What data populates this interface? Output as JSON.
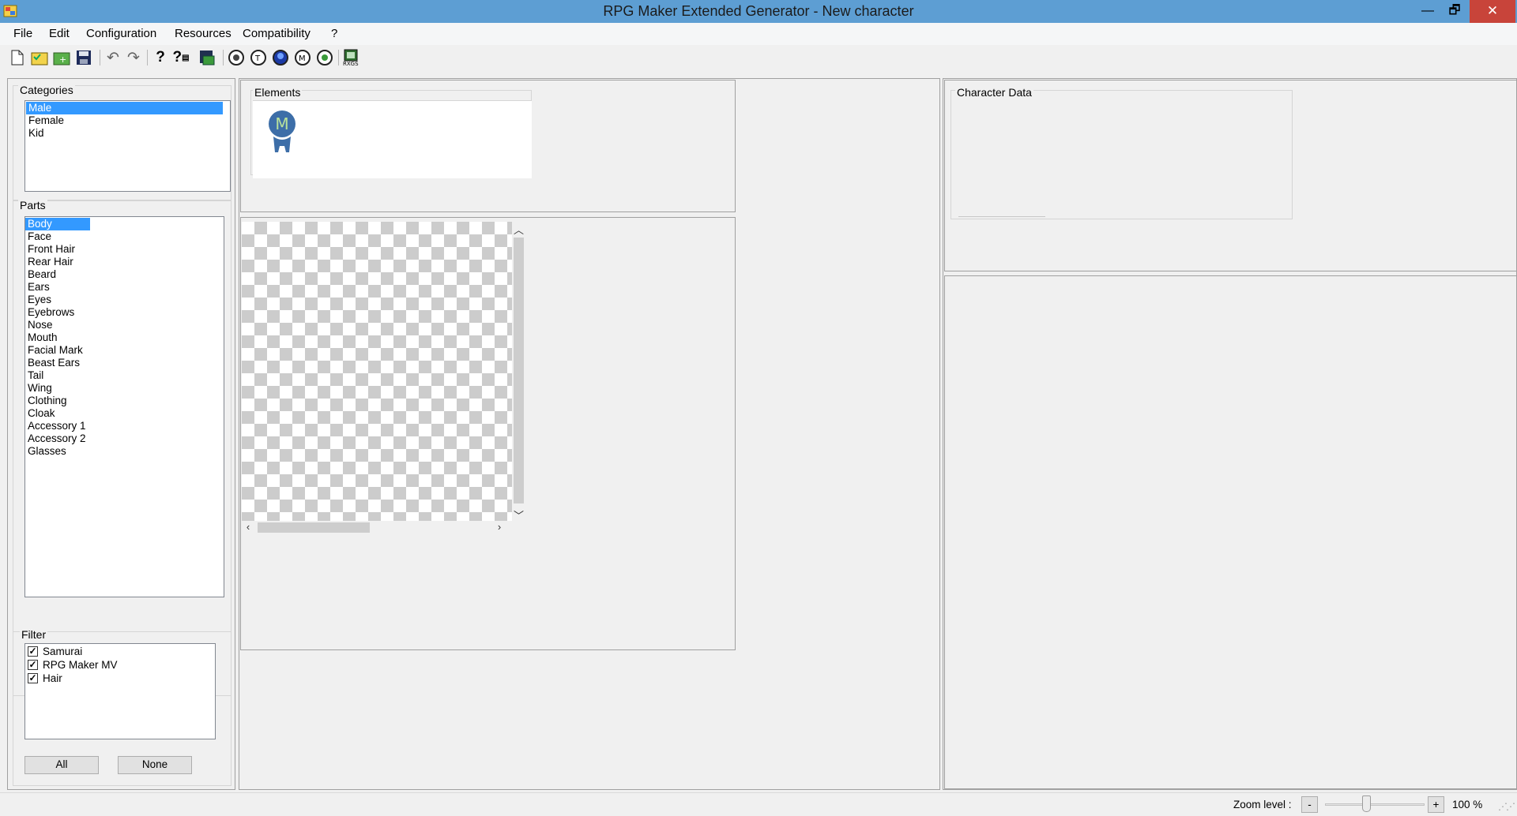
{
  "window": {
    "title": "RPG Maker Extended Generator - New character",
    "minimize": "—",
    "maximize": "🗗",
    "close": "✕"
  },
  "menu": [
    "File",
    "Edit",
    "Configuration",
    "Resources",
    "Compatibility",
    "?"
  ],
  "toolbar": {
    "icons": [
      "new-document-icon",
      "open-folder-icon",
      "add-folder-icon",
      "save-icon",
      "undo-icon",
      "redo-icon",
      "help-icon",
      "context-help-icon",
      "export-icon",
      "generate-icon-1",
      "generate-icon-2",
      "generate-icon-3",
      "generate-icon-4",
      "generate-icon-5",
      "xp-export-icon"
    ]
  },
  "categories": {
    "label": "Categories",
    "items": [
      "Male",
      "Female",
      "Kid"
    ],
    "selected": "Male"
  },
  "parts": {
    "label": "Parts",
    "items": [
      "Body",
      "Face",
      "Front Hair",
      "Rear Hair",
      "Beard",
      "Ears",
      "Eyes",
      "Eyebrows",
      "Nose",
      "Mouth",
      "Facial Mark",
      "Beast Ears",
      "Tail",
      "Wing",
      "Clothing",
      "Cloak",
      "Accessory 1",
      "Accessory 2",
      "Glasses"
    ],
    "selected": "Body"
  },
  "filter": {
    "label": "Filter",
    "items": [
      {
        "label": "Samurai",
        "checked": true
      },
      {
        "label": "RPG Maker MV",
        "checked": true
      },
      {
        "label": "Hair",
        "checked": true
      }
    ],
    "all_button": "All",
    "none_button": "None"
  },
  "elements": {
    "label": "Elements",
    "thumbnail_letter": "M"
  },
  "character_data": {
    "label": "Character Data"
  },
  "statusbar": {
    "zoom_label": "Zoom level :",
    "zoom_minus": "-",
    "zoom_plus": "+",
    "zoom_value": "100 %",
    "zoom_level": 1.0
  }
}
